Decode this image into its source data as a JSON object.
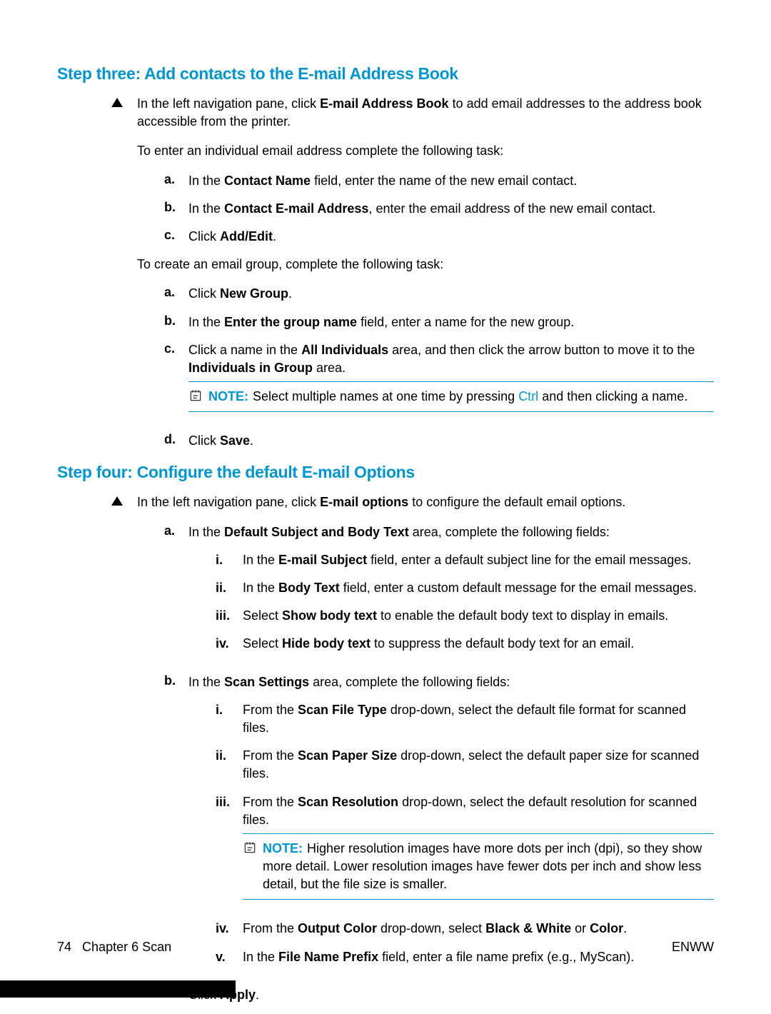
{
  "step3": {
    "heading": "Step three: Add contacts to the E-mail Address Book",
    "intro_pre": "In the left navigation pane, click ",
    "intro_bold": "E-mail Address Book",
    "intro_post": " to add email addresses to the address book accessible from the printer.",
    "task1_intro": "To enter an individual email address complete the following task:",
    "a_pre": "In the ",
    "a_bold": "Contact Name",
    "a_post": " field, enter the name of the new email contact.",
    "b_pre": "In the ",
    "b_bold": "Contact E-mail Address",
    "b_post": ", enter the email address of the new email contact.",
    "c_pre": "Click ",
    "c_bold": "Add/Edit",
    "c_post": ".",
    "task2_intro": "To create an email group, complete the following task:",
    "g_a_pre": "Click ",
    "g_a_bold": "New Group",
    "g_a_post": ".",
    "g_b_pre": "In the ",
    "g_b_bold": "Enter the group name",
    "g_b_post": " field, enter a name for the new group.",
    "g_c_pre": "Click a name in the ",
    "g_c_bold1": "All Individuals",
    "g_c_mid": " area, and then click the arrow button to move it to the ",
    "g_c_bold2": "Individuals in Group",
    "g_c_post": " area.",
    "note_label": "NOTE:",
    "note_pre": "Select multiple names at one time by pressing ",
    "note_kbd": "Ctrl",
    "note_post": " and then clicking a name.",
    "g_d_pre": "Click ",
    "g_d_bold": "Save",
    "g_d_post": "."
  },
  "step4": {
    "heading": "Step four: Configure the default E-mail Options",
    "intro_pre": "In the left navigation pane, click ",
    "intro_bold": "E-mail options",
    "intro_post": " to configure the default email options.",
    "a_pre": "In the ",
    "a_bold": "Default Subject and Body Text",
    "a_post": " area, complete the following fields:",
    "a_i_pre": "In the ",
    "a_i_bold": "E-mail Subject",
    "a_i_post": " field, enter a default subject line for the email messages.",
    "a_ii_pre": "In the ",
    "a_ii_bold": "Body Text",
    "a_ii_post": " field, enter a custom default message for the email messages.",
    "a_iii_pre": "Select ",
    "a_iii_bold": "Show body text",
    "a_iii_post": " to enable the default body text to display in emails.",
    "a_iv_pre": "Select ",
    "a_iv_bold": "Hide body text",
    "a_iv_post": " to suppress the default body text for an email.",
    "b_pre": "In the ",
    "b_bold": "Scan Settings",
    "b_post": " area, complete the following fields:",
    "b_i_pre": "From the ",
    "b_i_bold": "Scan File Type",
    "b_i_post": " drop-down, select the default file format for scanned files.",
    "b_ii_pre": "From the ",
    "b_ii_bold": "Scan Paper Size",
    "b_ii_post": " drop-down, select the default paper size for scanned files.",
    "b_iii_pre": "From the ",
    "b_iii_bold": "Scan Resolution",
    "b_iii_post": " drop-down, select the default resolution for scanned files.",
    "note_label": "NOTE:",
    "note_text": "Higher resolution images have more dots per inch (dpi), so they show more detail. Lower resolution images have fewer dots per inch and show less detail, but the file size is smaller.",
    "b_iv_pre": "From the ",
    "b_iv_bold": "Output Color",
    "b_iv_mid": " drop-down, select ",
    "b_iv_bold2": "Black & White",
    "b_iv_or": " or ",
    "b_iv_bold3": "Color",
    "b_iv_post": ".",
    "b_v_pre": "In the ",
    "b_v_bold": "File Name Prefix",
    "b_v_post": " field, enter a file name prefix (e.g., MyScan).",
    "c_pre": "Click ",
    "c_bold": "Apply",
    "c_post": "."
  },
  "footer": {
    "page": "74",
    "chapter": "Chapter 6   Scan",
    "right": "ENWW"
  },
  "markers": {
    "a": "a.",
    "b": "b.",
    "c": "c.",
    "d": "d.",
    "i": "i.",
    "ii": "ii.",
    "iii": "iii.",
    "iv": "iv.",
    "v": "v."
  }
}
